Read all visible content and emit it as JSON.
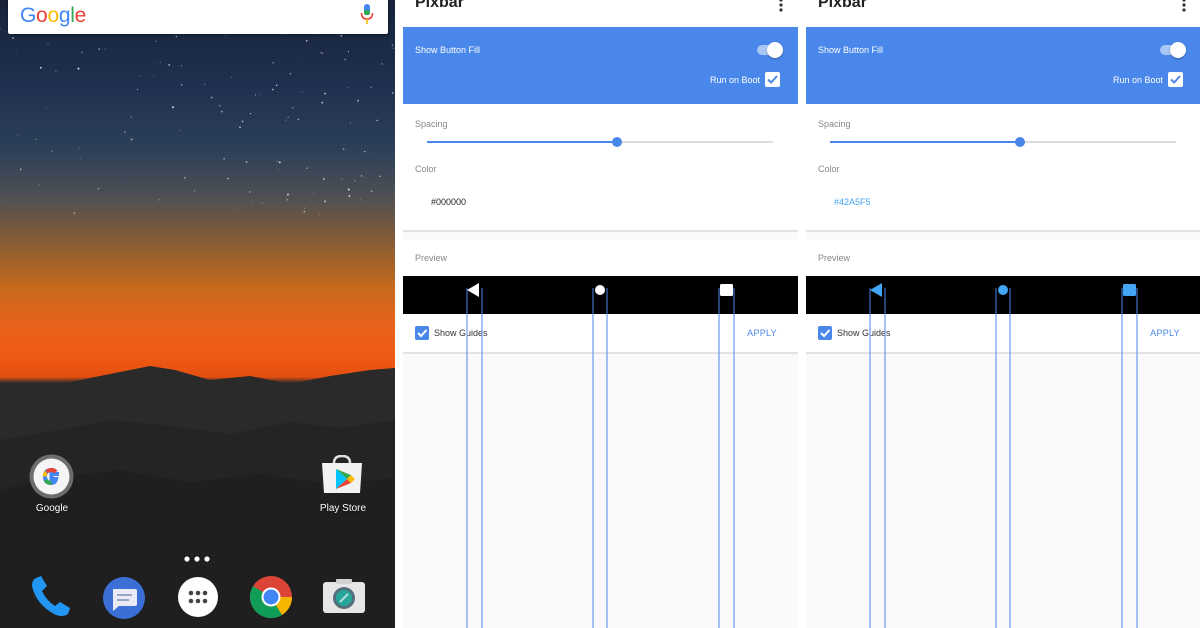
{
  "home": {
    "search": {
      "logo": "Google",
      "mic_icon": "mic-icon"
    },
    "apps": [
      {
        "label": "Google",
        "icon": "google-app-icon"
      },
      {
        "label": "Play Store",
        "icon": "play-store-icon"
      }
    ],
    "dock": [
      {
        "icon": "phone-icon"
      },
      {
        "icon": "messages-icon"
      },
      {
        "icon": "app-drawer-icon"
      },
      {
        "icon": "chrome-icon"
      },
      {
        "icon": "camera-icon"
      }
    ],
    "colors": {
      "sunset": "#ee5a14",
      "sky": "#1f3150",
      "mountains": "#262626"
    }
  },
  "panels": [
    {
      "title": "Pixbar",
      "show_button_fill": {
        "label": "Show Button Fill",
        "on": true
      },
      "run_on_boot": {
        "label": "Run on Boot",
        "checked": true
      },
      "spacing": {
        "label": "Spacing",
        "value_fraction": 0.55
      },
      "color": {
        "label": "Color",
        "value": "#000000",
        "value_color": "#222222"
      },
      "preview": {
        "label": "Preview",
        "button_color": "#ffffff"
      },
      "show_guides": {
        "label": "Show Guides",
        "checked": true
      },
      "apply_label": "APPLY"
    },
    {
      "title": "Pixbar",
      "show_button_fill": {
        "label": "Show Button Fill",
        "on": true
      },
      "run_on_boot": {
        "label": "Run on Boot",
        "checked": true
      },
      "spacing": {
        "label": "Spacing",
        "value_fraction": 0.55
      },
      "color": {
        "label": "Color",
        "value": "#42A5F5",
        "value_color": "#42A5F5"
      },
      "preview": {
        "label": "Preview",
        "button_color": "#42a5f5"
      },
      "show_guides": {
        "label": "Show Guides",
        "checked": true
      },
      "apply_label": "APPLY"
    }
  ],
  "colors": {
    "accent": "#4a87ea",
    "navbar": "#000000",
    "guide": "#4a87ea"
  }
}
